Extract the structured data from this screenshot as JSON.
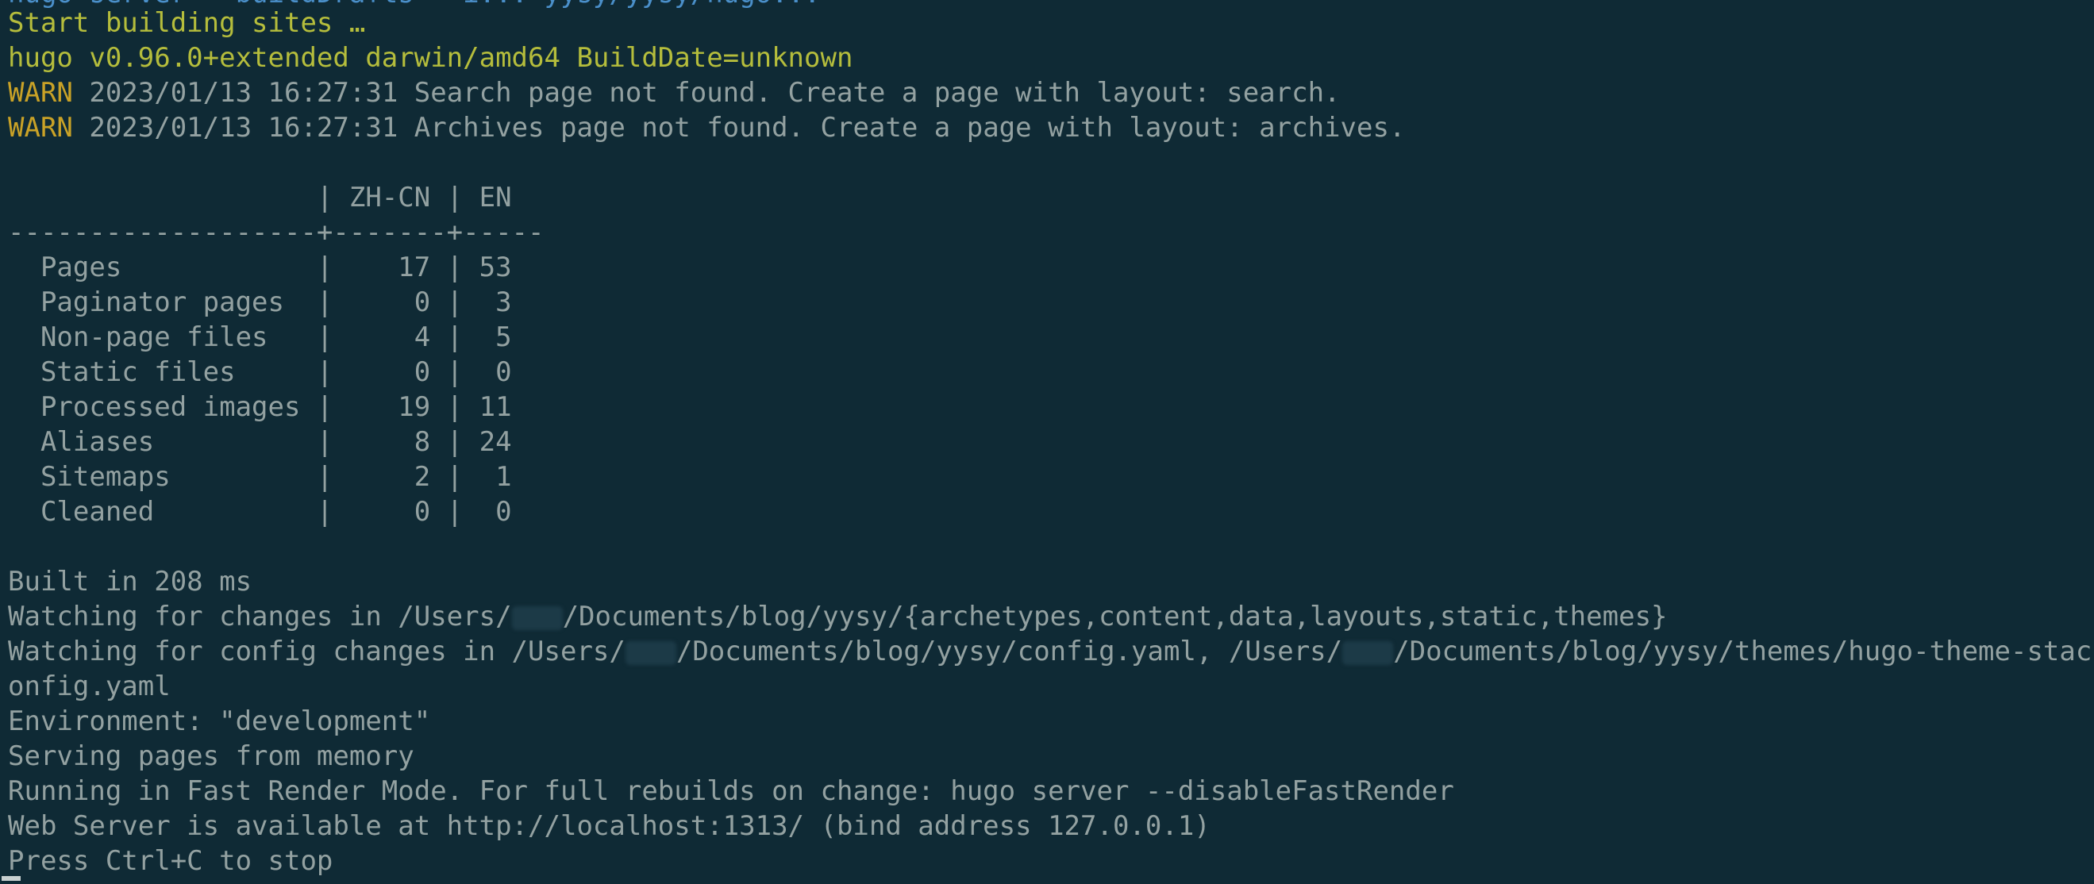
{
  "terminal": {
    "top_partial": "hugo server --buildDrafts --i... yysy/yysy/hugo...",
    "start": "Start building sites …",
    "version": "hugo v0.96.0+extended darwin/amd64 BuildDate=unknown",
    "warnings": [
      {
        "tag": "WARN",
        "text": " 2023/01/13 16:27:31 Search page not found. Create a page with layout: search."
      },
      {
        "tag": "WARN",
        "text": " 2023/01/13 16:27:31 Archives page not found. Create a page with layout: archives."
      }
    ],
    "table": {
      "header": "                   | ZH-CN | EN",
      "separator": "-------------------+-------+-----",
      "rows": [
        "  Pages            |    17 | 53",
        "  Paginator pages  |     0 |  3",
        "  Non-page files   |     4 |  5",
        "  Static files     |     0 |  0",
        "  Processed images |    19 | 11",
        "  Aliases          |     8 | 24",
        "  Sitemaps         |     2 |  1",
        "  Cleaned          |     0 |  0"
      ]
    },
    "built": "Built in 208 ms",
    "watching": {
      "prefix": "Watching for changes in /Users/",
      "suffix": "/Documents/blog/yysy/{archetypes,content,data,layouts,static,themes}"
    },
    "watching_config": {
      "prefix": "Watching for config changes in /Users/",
      "middle": "/Documents/blog/yysy/config.yaml, /Users/",
      "suffix": "/Documents/blog/yysy/themes/hugo-theme-stack/c",
      "wrap": "onfig.yaml"
    },
    "environment": "Environment: \"development\"",
    "serving": "Serving pages from memory",
    "fast_render": "Running in Fast Render Mode. For full rebuilds on change: hugo server --disableFastRender",
    "web_server": "Web Server is available at http://localhost:1313/ (bind address 127.0.0.1)",
    "press": "Press Ctrl+C to stop"
  },
  "colors": {
    "background": "#0f2a35",
    "text": "#93a1a1",
    "yellow": "#b5bd3c",
    "warn": "#c9a227"
  }
}
